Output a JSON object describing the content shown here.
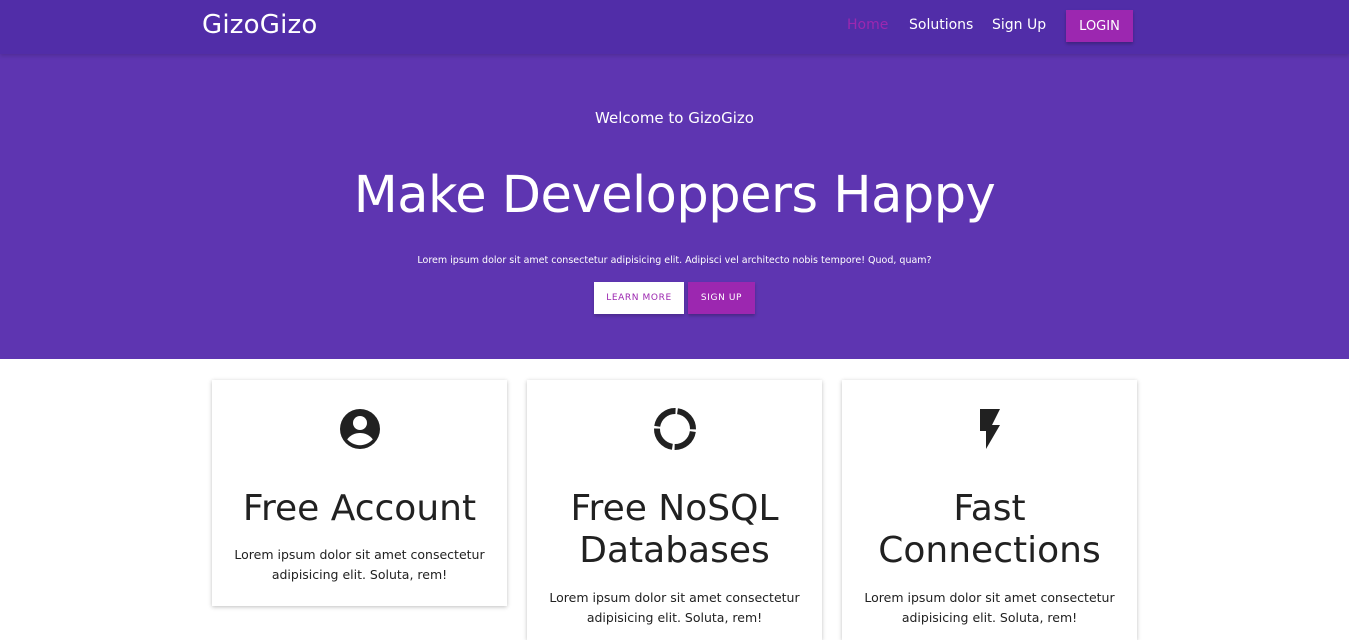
{
  "navbar": {
    "brand": "GizoGizo",
    "links": [
      {
        "label": "Home",
        "active": true
      },
      {
        "label": "Solutions",
        "active": false
      },
      {
        "label": "Sign Up",
        "active": false
      }
    ],
    "login_label": "LOGIN"
  },
  "hero": {
    "welcome": "Welcome to GizoGizo",
    "title": "Make Developpers Happy",
    "text": "Lorem ipsum dolor sit amet consectetur adipisicing elit. Adipisci vel architecto nobis tempore! Quod, quam?",
    "learn_more_label": "LEARN MORE",
    "sign_up_label": "SIGN UP"
  },
  "features": [
    {
      "icon": "account-circle-icon",
      "title": "Free Account",
      "text": "Lorem ipsum dolor sit amet consectetur adipisicing elit. Soluta, rem!"
    },
    {
      "icon": "donut-icon",
      "title": "Free NoSQL Databases",
      "text": "Lorem ipsum dolor sit amet consectetur adipisicing elit. Soluta, rem!"
    },
    {
      "icon": "flash-icon",
      "title": "Fast Connections",
      "text": "Lorem ipsum dolor sit amet consectetur adipisicing elit. Soluta, rem!"
    }
  ],
  "colors": {
    "navbar": "#512da8",
    "hero": "#5e35b1",
    "accent": "#9c27b0"
  }
}
